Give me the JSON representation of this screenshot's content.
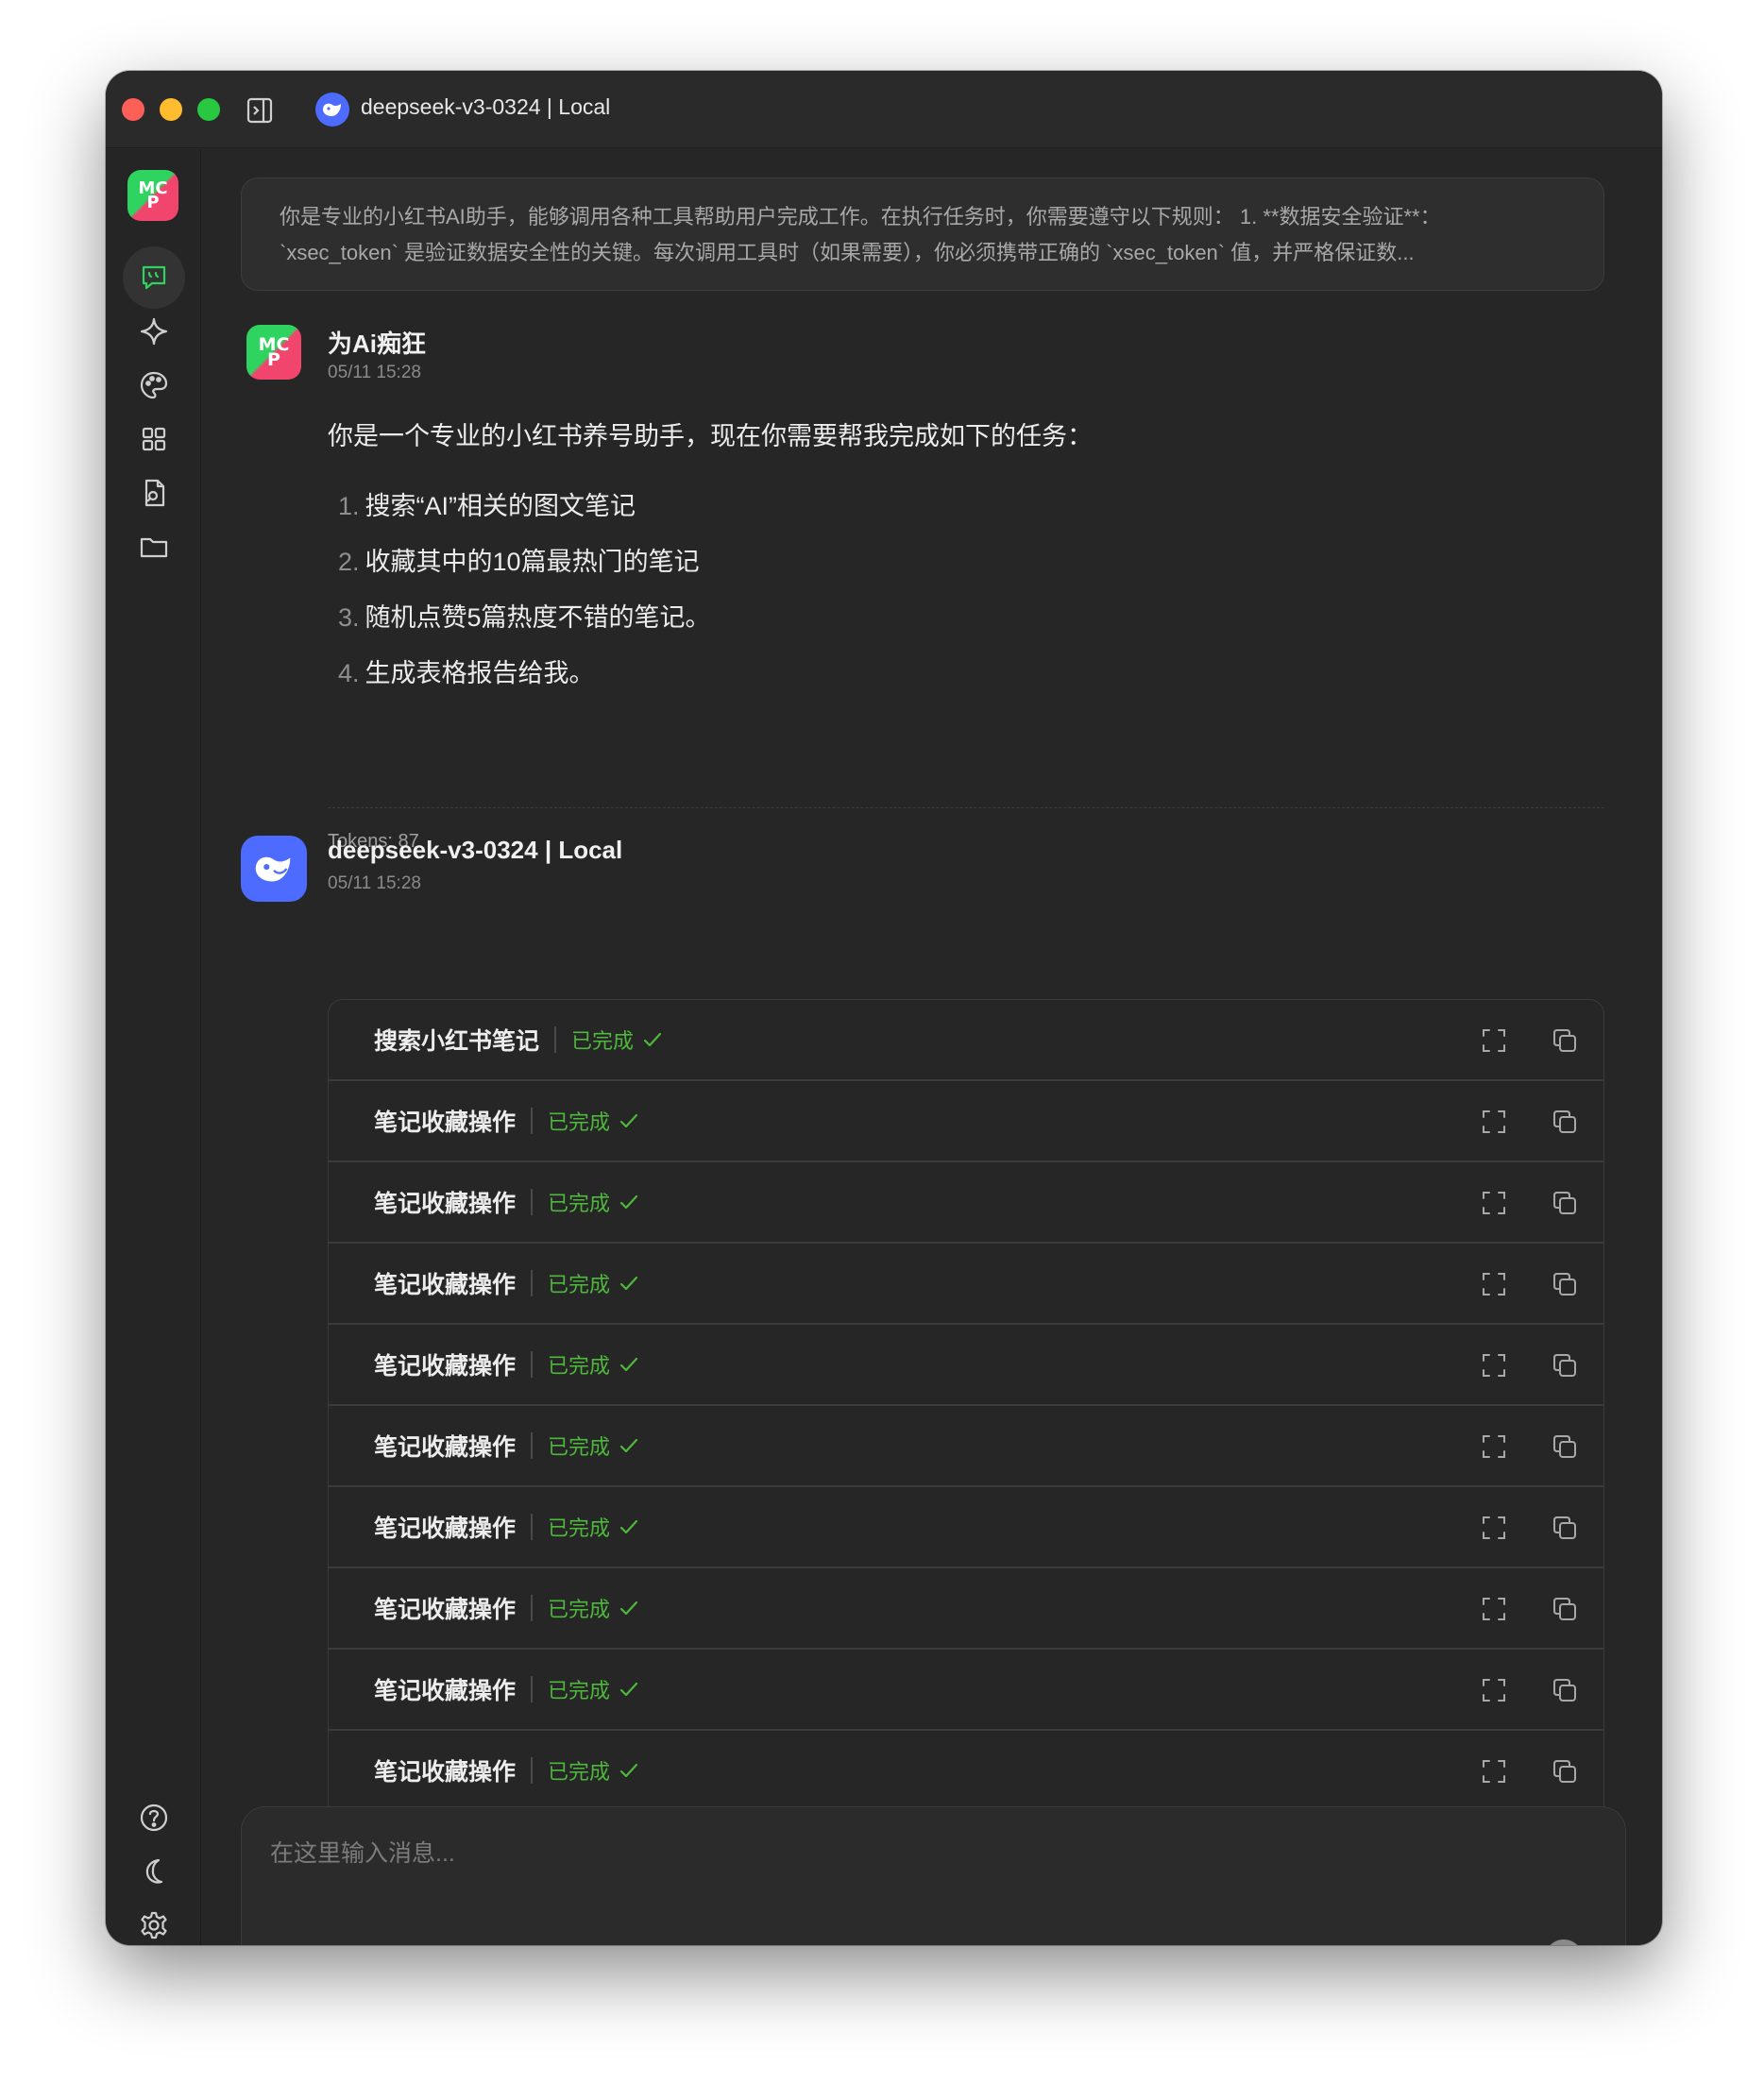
{
  "window": {
    "title": "deepseek-v3-0324 | Local"
  },
  "colors": {
    "accent_green": "#2fd35f",
    "status_green": "#4eb83c",
    "deepseek_blue": "#4d6bfe",
    "background": "#262626"
  },
  "sidebar": {
    "logo_text": "MCP",
    "items": [
      {
        "name": "chat-icon",
        "active": true
      },
      {
        "name": "sparkle-icon",
        "active": false
      },
      {
        "name": "palette-icon",
        "active": false
      },
      {
        "name": "apps-grid-icon",
        "active": false
      },
      {
        "name": "document-search-icon",
        "active": false
      },
      {
        "name": "folder-icon",
        "active": false
      }
    ],
    "bottom_items": [
      {
        "name": "help-icon"
      },
      {
        "name": "moon-icon"
      },
      {
        "name": "settings-icon"
      }
    ]
  },
  "system_prompt": {
    "line1": "你是专业的小红书AI助手，能够调用各种工具帮助用户完成工作。在执行任务时，你需要遵守以下规则： 1. **数据安全验证**：",
    "line2": "`xsec_token` 是验证数据安全性的关键。每次调用工具时（如果需要），你必须携带正确的 `xsec_token` 值，并严格保证数..."
  },
  "user_message": {
    "name": "为Ai痴狂",
    "time": "05/11 15:28",
    "intro": "你是一个专业的小红书养号助手，现在你需要帮我完成如下的任务：",
    "tasks": [
      {
        "num": "1.",
        "text": "搜索“AI”相关的图文笔记"
      },
      {
        "num": "2.",
        "text": "收藏其中的10篇最热门的笔记"
      },
      {
        "num": "3.",
        "text": "随机点赞5篇热度不错的笔记。"
      },
      {
        "num": "4.",
        "text": "生成表格报告给我。"
      }
    ],
    "tokens": "Tokens: 87"
  },
  "assistant_message": {
    "name": "deepseek-v3-0324 | Local",
    "time": "05/11 15:28",
    "tool_calls": [
      {
        "name": "搜索小红书笔记",
        "status": "已完成"
      },
      {
        "name": "笔记收藏操作",
        "status": "已完成"
      },
      {
        "name": "笔记收藏操作",
        "status": "已完成"
      },
      {
        "name": "笔记收藏操作",
        "status": "已完成"
      },
      {
        "name": "笔记收藏操作",
        "status": "已完成"
      },
      {
        "name": "笔记收藏操作",
        "status": "已完成"
      },
      {
        "name": "笔记收藏操作",
        "status": "已完成"
      },
      {
        "name": "笔记收藏操作",
        "status": "已完成"
      },
      {
        "name": "笔记收藏操作",
        "status": "已完成"
      },
      {
        "name": "笔记收藏操作",
        "status": "已完成"
      }
    ]
  },
  "composer": {
    "placeholder": "在这里输入消息...",
    "value": "",
    "tools": [
      "new-topic-icon",
      "attachment-icon",
      "web-search-icon",
      "knowledge-base-icon",
      "mcp-server-icon",
      "mention-model-icon",
      "quick-phrase-icon",
      "pin-icon",
      "collapse-icon",
      "clear-icon"
    ],
    "right_tools": [
      "translate-icon",
      "send-icon"
    ]
  }
}
